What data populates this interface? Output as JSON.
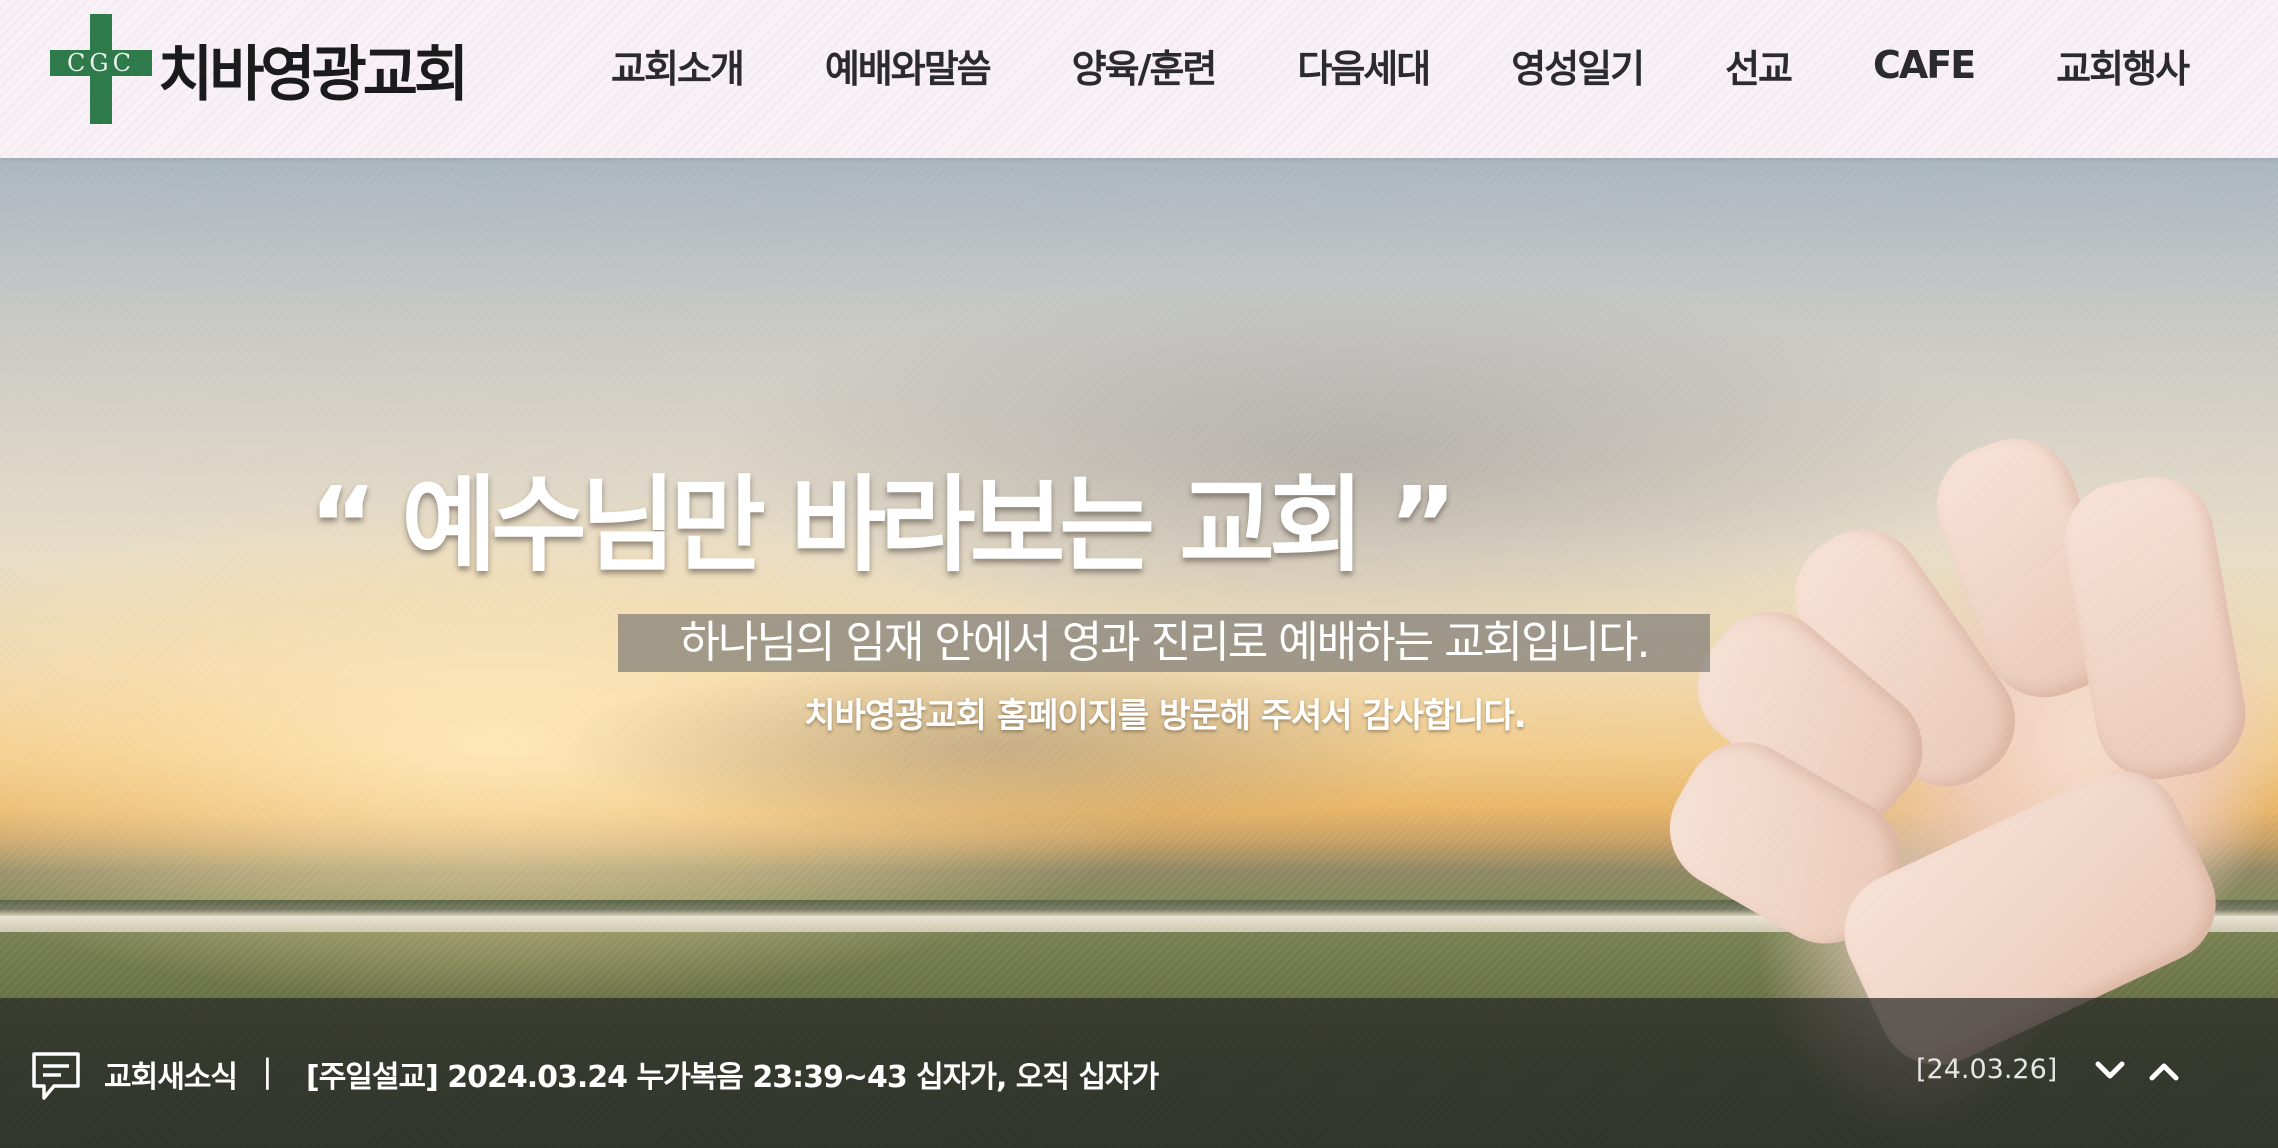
{
  "logo": {
    "mark_text": "CGC",
    "name": "치바영광교회",
    "brand_color": "#2f7a4a"
  },
  "nav": {
    "items": [
      {
        "label": "교회소개"
      },
      {
        "label": "예배와말씀"
      },
      {
        "label": "양육/훈련"
      },
      {
        "label": "다음세대"
      },
      {
        "label": "영성일기"
      },
      {
        "label": "선교"
      },
      {
        "label": "CAFE"
      },
      {
        "label": "교회행사"
      }
    ]
  },
  "hero": {
    "quote": "“ 예수님만 바라보는 교회 ”",
    "subtitle": "하나님의 임재 안에서 영과 진리로 예배하는 교회입니다.",
    "welcome": "치바영광교회 홈페이지를 방문해 주셔서 감사합니다."
  },
  "news": {
    "icon": "speech-bubble-icon",
    "label": "교회새소식",
    "separator": "|",
    "title": "[주일설교] 2024.03.24 누가복음 23:39~43 십자가, 오직 십자가",
    "date": "[24.03.26]",
    "prev_icon": "chevron-down-icon",
    "next_icon": "chevron-up-icon"
  }
}
